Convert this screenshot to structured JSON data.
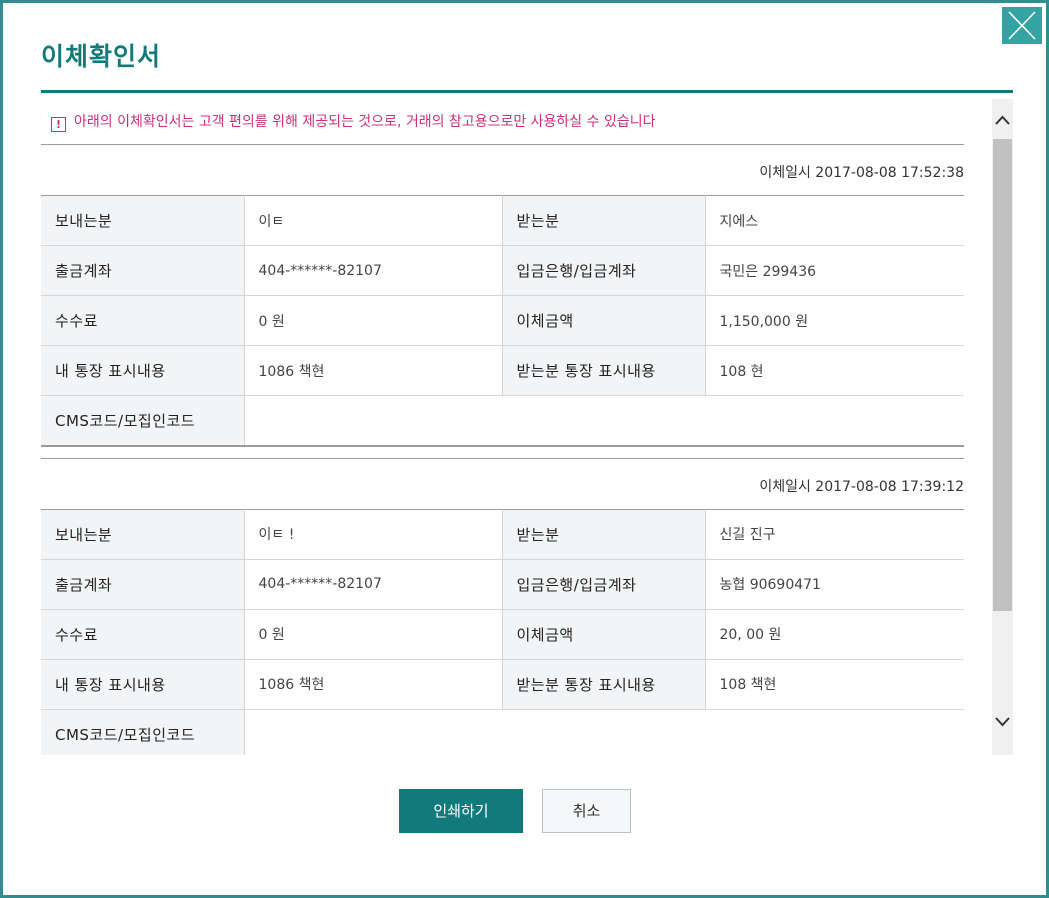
{
  "dialog": {
    "title": "이체확인서",
    "notice": "아래의 이체확인서는 고객 편의를 위해 제공되는 것으로, 거래의 참고용으로만 사용하실 수 있습니다",
    "close_icon": "close-icon",
    "accent_color": "#117a7a"
  },
  "labels": {
    "sender": "보내는분",
    "receiver": "받는분",
    "withdraw_account": "출금계좌",
    "deposit_bank_account": "입금은행/입금계좌",
    "fee": "수수료",
    "transfer_amount": "이체금액",
    "my_memo": "내 통장 표시내용",
    "receiver_memo": "받는분 통장 표시내용",
    "cms_code": "CMS코드/모집인코드"
  },
  "records": [
    {
      "date_label": "이체일시 2017-08-08 17:52:38",
      "sender": "이ㅌ",
      "receiver": "지에스",
      "withdraw_account": "404-******-82107",
      "deposit_bank_account": "국민은                    299436",
      "fee": "0 원",
      "transfer_amount": "1,150,000 원",
      "my_memo": "1086          책현",
      "receiver_memo": "108            현",
      "cms_code": ""
    },
    {
      "date_label": "이체일시 2017-08-08 17:39:12",
      "sender": "이ㅌ  !",
      "receiver": "신길                    진구",
      "withdraw_account": "404-******-82107",
      "deposit_bank_account": "농협             90690471",
      "fee": "0 원",
      "transfer_amount": "20,        00 원",
      "my_memo": "1086          책현",
      "receiver_memo": "108          책현",
      "cms_code": ""
    }
  ],
  "buttons": {
    "print": "인쇄하기",
    "cancel": "취소"
  }
}
